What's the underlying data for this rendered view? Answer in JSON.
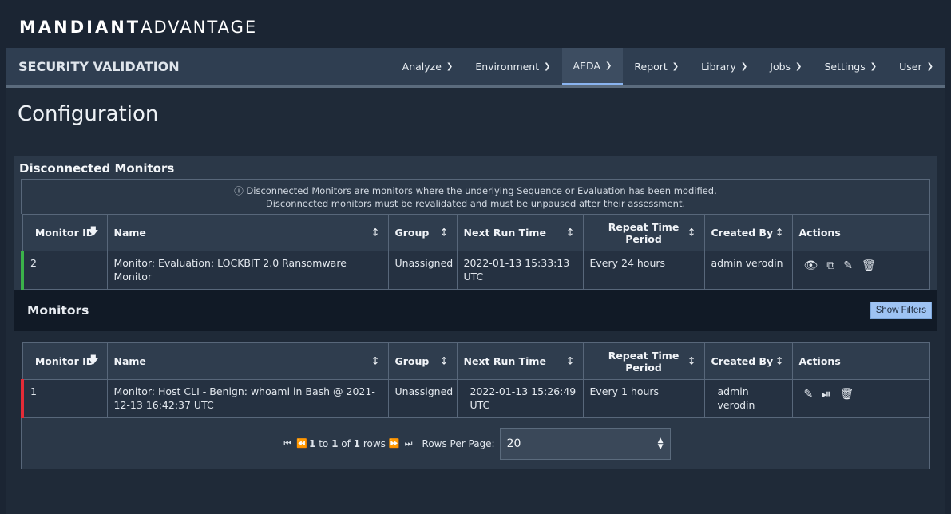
{
  "brand": {
    "part1": "MANDIANT",
    "part2": "ADVANTAGE"
  },
  "nav": {
    "section_title": "SECURITY VALIDATION",
    "items": [
      "Analyze",
      "Environment",
      "AEDA",
      "Report",
      "Library",
      "Jobs",
      "Settings",
      "User"
    ],
    "active": "AEDA"
  },
  "page": {
    "title": "Configuration"
  },
  "disconnected": {
    "heading": "Disconnected Monitors",
    "notice_line1": "Disconnected Monitors are monitors where the underlying Sequence or Evaluation has been modified.",
    "notice_line2": "Disconnected monitors must be revalidated and must be unpaused after their assessment.",
    "columns": {
      "id": "Monitor ID",
      "name": "Name",
      "group": "Group",
      "next_run": "Next Run Time",
      "repeat": "Repeat Time Period",
      "created_by": "Created By",
      "actions": "Actions"
    },
    "rows": [
      {
        "id": "2",
        "name": "Monitor: Evaluation: LOCKBIT 2.0 Ransomware Monitor",
        "group": "Unassigned",
        "next_run": "2022-01-13 15:33:13 UTC",
        "repeat": "Every 24 hours",
        "created_by": "admin verodin",
        "status_color": "#3bb24a"
      }
    ]
  },
  "monitors": {
    "heading": "Monitors",
    "show_filters": "Show Filters",
    "columns": {
      "id": "Monitor ID",
      "name": "Name",
      "group": "Group",
      "next_run": "Next Run Time",
      "repeat": "Repeat Time Period",
      "created_by": "Created By",
      "actions": "Actions"
    },
    "rows": [
      {
        "id": "1",
        "name": "Monitor: Host CLI - Benign: whoami in Bash @ 2021-12-13 16:42:37 UTC",
        "group": "Unassigned",
        "next_run": "2022-01-13 15:26:49 UTC",
        "repeat": "Every 1 hours",
        "created_by": "admin verodin",
        "status_color": "#e32b37"
      }
    ],
    "pager": {
      "range_start": "1",
      "to": "to",
      "range_end": "1",
      "of": "of",
      "total": "1",
      "rows_word": "rows",
      "rows_per_page_label": "Rows Per Page:",
      "rows_per_page_value": "20"
    }
  },
  "icons": {
    "view": "eye-icon",
    "export": "external-link-icon",
    "edit": "pencil-icon",
    "pause": "pause-icon",
    "delete": "trash-icon",
    "info": "info-icon",
    "sort_desc": "arrow-down-icon",
    "sort": "sort-icon"
  }
}
